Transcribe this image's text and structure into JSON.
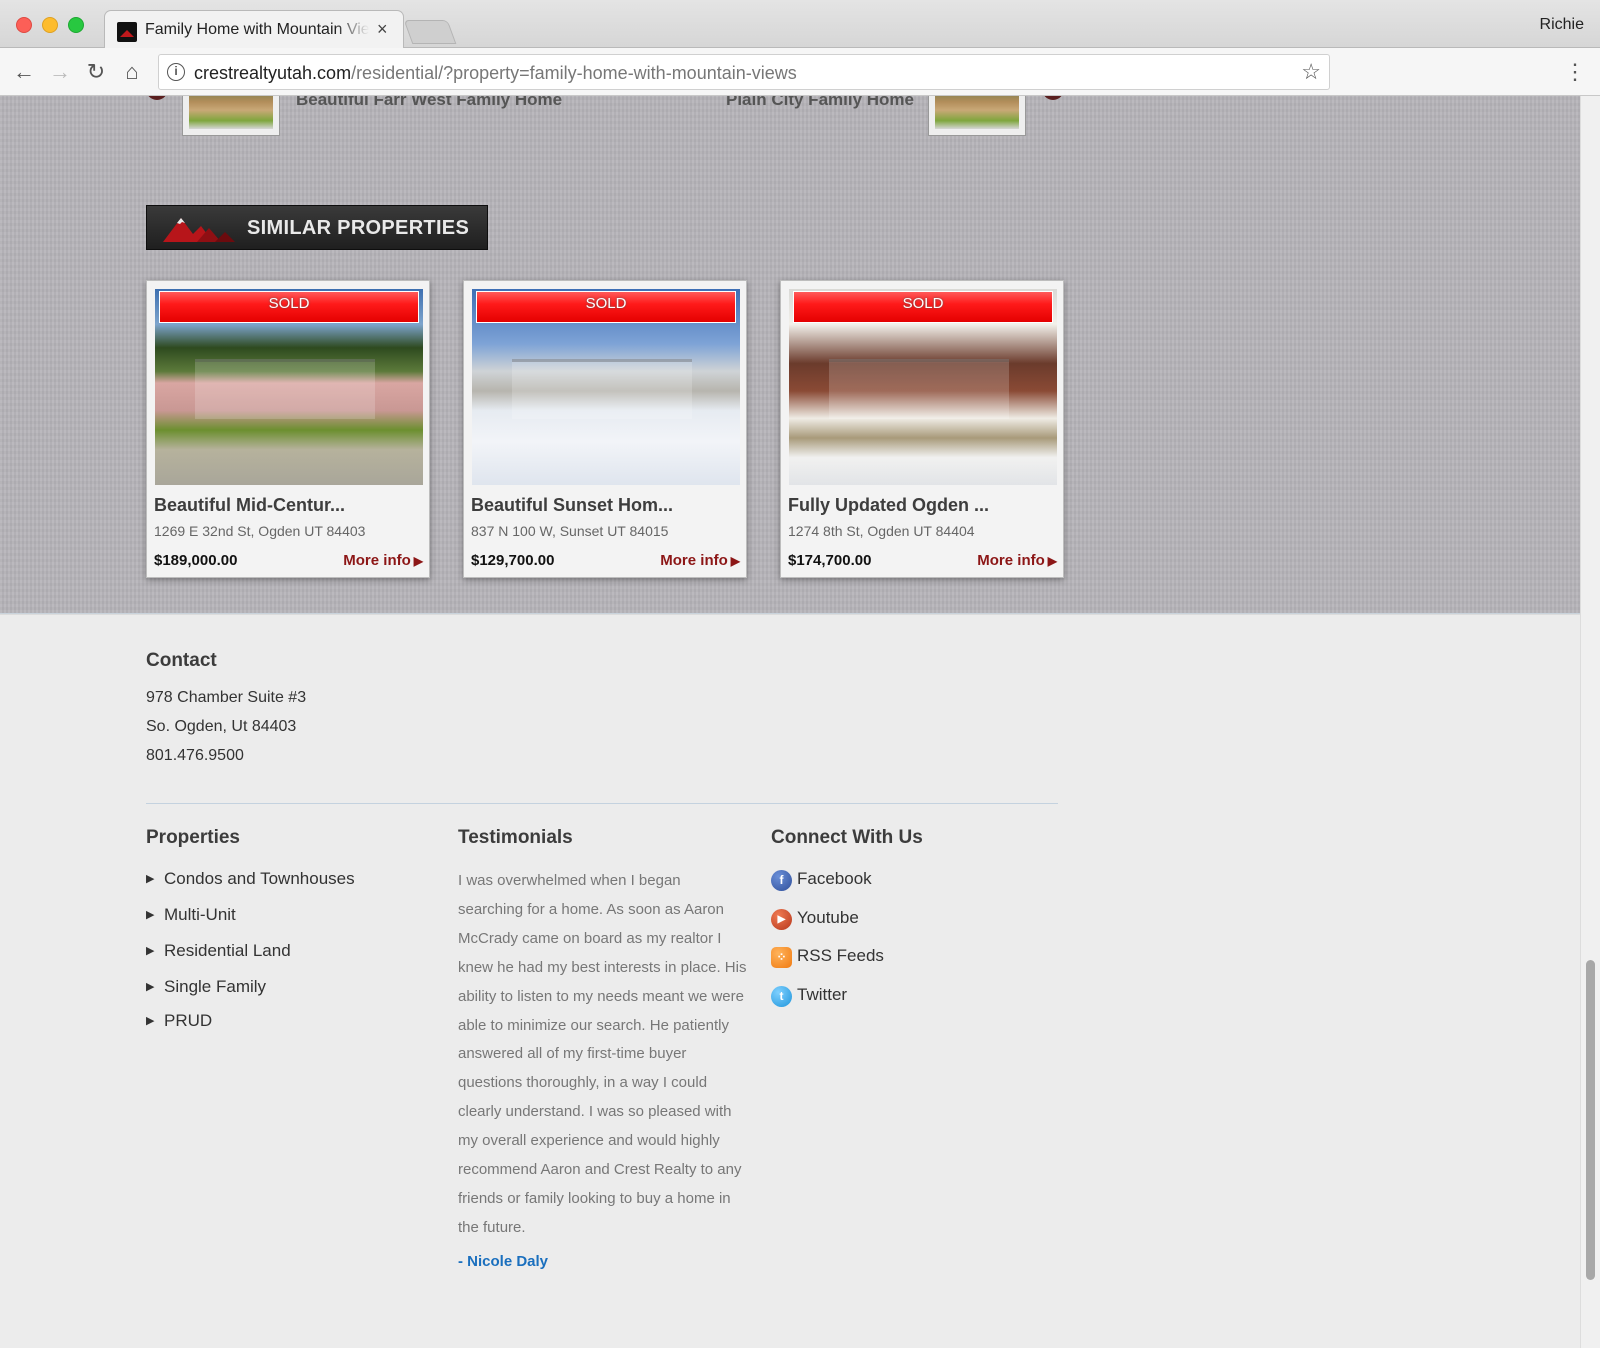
{
  "browser": {
    "tab_title": "Family Home with Mountain Views",
    "tab_close": "×",
    "profile_name": "Richie",
    "url_host": "crestrealtyutah.com",
    "url_path": "/residential/?property=family-home-with-mountain-views",
    "icons": {
      "back": "back-arrow-icon",
      "forward": "forward-arrow-icon",
      "reload": "reload-icon",
      "home": "home-icon",
      "info": "info-icon",
      "bookmark": "star-icon",
      "menu": "kebab-menu-icon"
    }
  },
  "adjacent": {
    "prev_label": "Beautiful Farr West Family Home",
    "next_label": "Plain City Family Home"
  },
  "similar": {
    "heading": "SIMILAR PROPERTIES",
    "cards": [
      {
        "badge": "SOLD",
        "title": "Beautiful Mid-Centur...",
        "address": "1269 E 32nd St, Ogden UT 84403",
        "price": "$189,000.00",
        "more": "More info"
      },
      {
        "badge": "SOLD",
        "title": "Beautiful Sunset Hom...",
        "address": "837 N 100 W, Sunset UT 84015",
        "price": "$129,700.00",
        "more": "More info"
      },
      {
        "badge": "SOLD",
        "title": "Fully Updated Ogden ...",
        "address": "1274 8th St, Ogden UT 84404",
        "price": "$174,700.00",
        "more": "More info"
      }
    ]
  },
  "footer": {
    "contact": {
      "title": "Contact",
      "lines": [
        "978 Chamber Suite #3",
        "So. Ogden, Ut 84403",
        "801.476.9500"
      ]
    },
    "properties": {
      "title": "Properties",
      "items": [
        "Condos and Townhouses",
        "Multi-Unit",
        "Residential Land",
        "Single Family",
        "PRUD"
      ]
    },
    "testimonials": {
      "title": "Testimonials",
      "text": "I was overwhelmed when I began searching for a home. As soon as Aaron McCrady came on board as my realtor I knew he had my best interests in place. His ability to listen to my needs meant we were able to minimize our search. He patiently answered all of my first-time buyer questions thoroughly, in a way I could clearly understand. I was so pleased with my overall experience and would highly recommend Aaron and Crest Realty to any friends or family looking to buy a home in the future.",
      "author": "- Nicole Daly"
    },
    "connect": {
      "title": "Connect With Us",
      "items": [
        {
          "label": "Facebook",
          "icon": "facebook-icon"
        },
        {
          "label": "Youtube",
          "icon": "youtube-icon"
        },
        {
          "label": "RSS Feeds",
          "icon": "rss-icon"
        },
        {
          "label": "Twitter",
          "icon": "twitter-icon"
        }
      ]
    }
  },
  "colors": {
    "accent_red": "#e40000",
    "more_info": "#8c1616",
    "link_blue": "#1a6fbe",
    "band_gray": "#b6b4b9"
  }
}
